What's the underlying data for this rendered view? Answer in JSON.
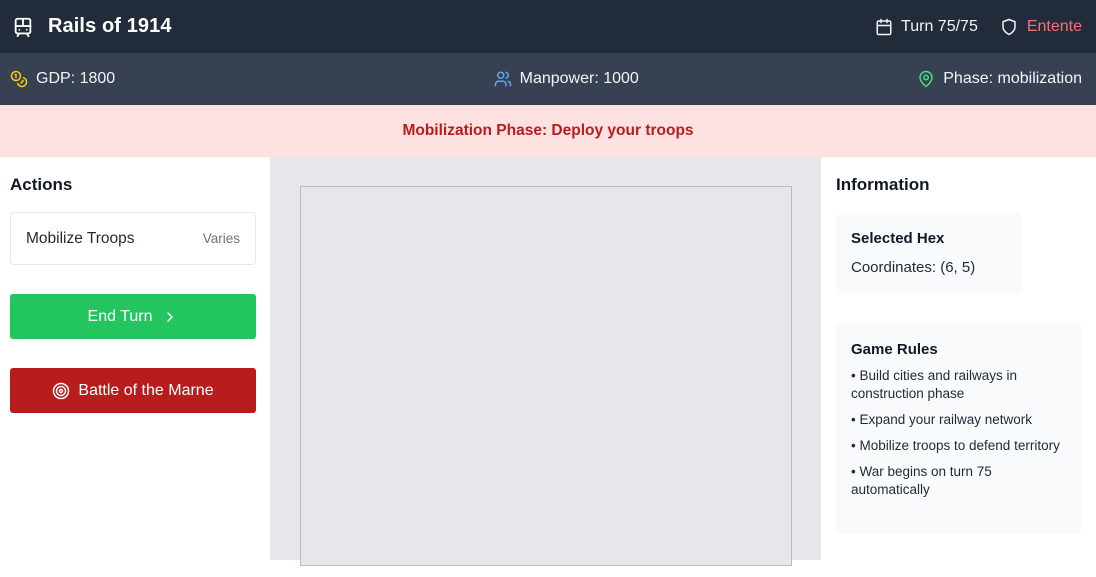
{
  "header": {
    "title": "Rails of 1914",
    "logo_icon": "train-icon",
    "turn_label": "Turn 75/75",
    "turn_icon": "calendar-icon",
    "faction": "Entente",
    "faction_icon": "shield-icon",
    "faction_color": "#f87171"
  },
  "stats": {
    "gdp": "GDP: 1800",
    "gdp_icon": "coins-icon",
    "manpower": "Manpower: 1000",
    "manpower_icon": "users-icon",
    "phase": "Phase: mobilization",
    "phase_icon": "map-pin-icon"
  },
  "banner": {
    "text": "Mobilization Phase: Deploy your troops",
    "color": "#b91c1c",
    "background": "#fee2e2"
  },
  "actions": {
    "heading": "Actions",
    "items": [
      {
        "name": "Mobilize Troops",
        "cost": "Varies"
      }
    ],
    "end_turn_label": "End Turn",
    "end_turn_color": "#22c55e",
    "battle_label": "Battle of the Marne",
    "battle_color": "#b91c1c"
  },
  "info": {
    "heading": "Information",
    "selected_hex": {
      "title": "Selected Hex",
      "coordinates": "Coordinates: (6, 5)"
    },
    "rules": {
      "title": "Game Rules",
      "items": [
        "• Build cities and railways in construction phase",
        "• Expand your railway network",
        "• Mobilize troops to defend territory",
        "• War begins on turn 75 automatically"
      ]
    }
  }
}
